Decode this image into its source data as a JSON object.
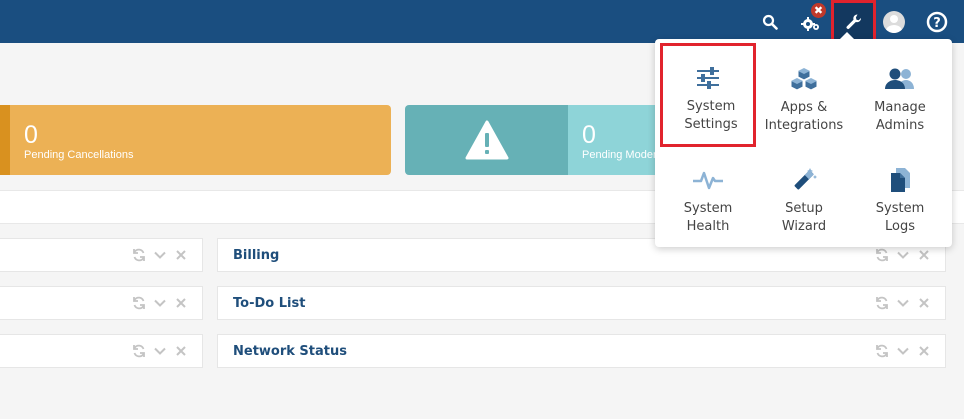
{
  "topbar": {
    "icons": [
      "search-icon",
      "gears-icon",
      "wrench-icon",
      "avatar",
      "help-icon"
    ],
    "badge": "✖",
    "colors": {
      "bar": "#1a4e80",
      "active": "#13385f",
      "highlight": "#e1232d"
    }
  },
  "stats": [
    {
      "value": "0",
      "label": "Pending Cancellations",
      "color": "#ecb155"
    },
    {
      "value": "0",
      "label": "Pending Moderation",
      "color": "#8ed4d8"
    }
  ],
  "panels": {
    "left": [
      {},
      {},
      {}
    ],
    "right": [
      {
        "title": "Billing"
      },
      {
        "title": "To-Do List"
      },
      {
        "title": "Network Status"
      }
    ]
  },
  "dropdown": {
    "items": [
      {
        "label_line1": "System",
        "label_line2": "Settings",
        "icon": "sliders-icon"
      },
      {
        "label_line1": "Apps &",
        "label_line2": "Integrations",
        "icon": "cubes-icon"
      },
      {
        "label_line1": "Manage",
        "label_line2": "Admins",
        "icon": "users-icon"
      },
      {
        "label_line1": "System",
        "label_line2": "Health",
        "icon": "heartbeat-icon"
      },
      {
        "label_line1": "Setup",
        "label_line2": "Wizard",
        "icon": "magic-wand-icon"
      },
      {
        "label_line1": "System",
        "label_line2": "Logs",
        "icon": "files-icon"
      }
    ]
  }
}
